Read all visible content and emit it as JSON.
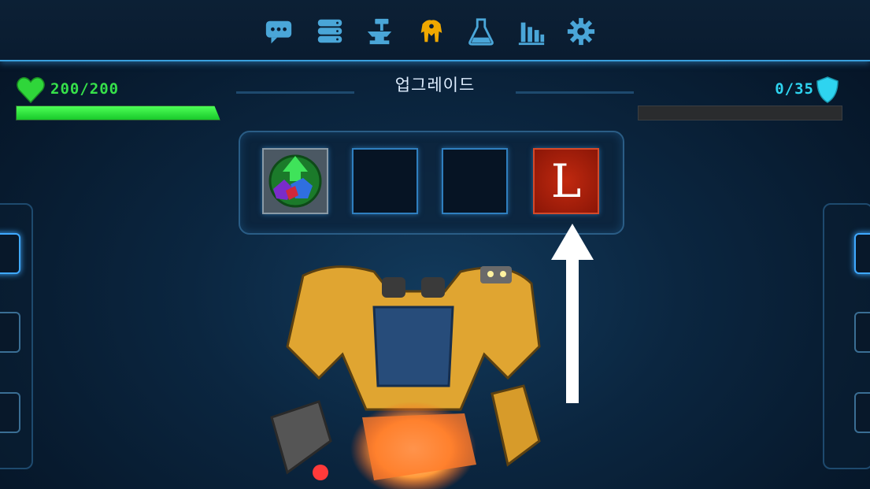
{
  "nav": {
    "items": [
      {
        "name": "chat-icon",
        "active": false
      },
      {
        "name": "database-icon",
        "active": false
      },
      {
        "name": "anvil-hammer-icon",
        "active": false
      },
      {
        "name": "mech-icon",
        "active": true
      },
      {
        "name": "flask-icon",
        "active": false
      },
      {
        "name": "stats-icon",
        "active": false
      },
      {
        "name": "gear-icon",
        "active": false
      }
    ],
    "active_color": "#f0a800",
    "inactive_color": "#4aa6d8"
  },
  "header": {
    "title": "업그레이드"
  },
  "health": {
    "text": "200/200",
    "current": 200,
    "max": 200,
    "color": "#36e04a"
  },
  "shield": {
    "text": "0/35",
    "current": 0,
    "max": 35,
    "color": "#2ed4f0"
  },
  "upgrade_slots": [
    {
      "type": "gem-upgrade-icon",
      "filled": true
    },
    {
      "type": "empty",
      "filled": false
    },
    {
      "type": "empty",
      "filled": false
    },
    {
      "type": "letter-tile",
      "filled": true,
      "letter": "L"
    }
  ],
  "pointer": {
    "icon": "arrow-up-icon",
    "color": "#ffffff"
  }
}
